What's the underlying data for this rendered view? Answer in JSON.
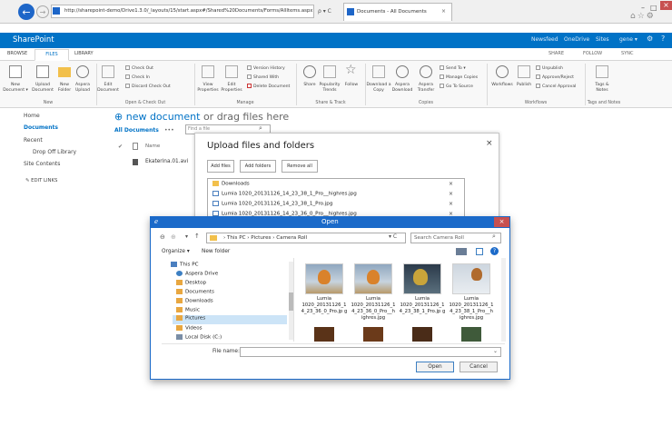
{
  "browser": {
    "url": "http://sharepoint-demo/Drive1.3.0/_layouts/15/start.aspx#/Shared%20Documents/Forms/AllItems.aspx",
    "tab_title": "Documents - All Documents",
    "addr_controls": "ρ ▾ C",
    "minimize": "–",
    "maximize": "□",
    "close": "×",
    "icons": "⌂☆⚙"
  },
  "suite": {
    "title": "SharePoint",
    "links": [
      "Newsfeed",
      "OneDrive",
      "Sites",
      "gene ▾",
      "⚙",
      "?"
    ]
  },
  "ribbon": {
    "tabs": [
      "BROWSE",
      "FILES",
      "LIBRARY"
    ],
    "actions": [
      "SHARE",
      "FOLLOW",
      "SYNC"
    ],
    "buttons": {
      "new_document": "New\nDocument ▾",
      "upload_document": "Upload\nDocument",
      "new_folder": "New\nFolder",
      "aspera_upload": "Aspera\nUpload",
      "edit_document": "Edit\nDocument",
      "view_properties": "View\nProperties",
      "edit_properties": "Edit\nProperties",
      "share": "Share",
      "popularity_trends": "Popularity\nTrends",
      "follow": "Follow",
      "download_copy": "Download a\nCopy",
      "aspera_download": "Aspera\nDownload",
      "aspera_transfer": "Aspera\nTransfer",
      "workflows": "Workflows",
      "publish": "Publish",
      "tags_notes": "Tags &\nNotes"
    },
    "small": {
      "check_out": "Check Out",
      "check_in": "Check In",
      "discard_check_out": "Discard Check Out",
      "version_history": "Version History",
      "shared_with": "Shared With",
      "delete_document": "Delete Document",
      "send_to": "Send To ▾",
      "manage_copies": "Manage Copies",
      "go_to_source": "Go To Source",
      "unpublish": "Unpublish",
      "approve_reject": "Approve/Reject",
      "cancel_approval": "Cancel Approval"
    },
    "groups": [
      "New",
      "Open & Check Out",
      "Manage",
      "Share & Track",
      "Copies",
      "Workflows",
      "Tags and Notes"
    ]
  },
  "leftnav": {
    "items": [
      "Home",
      "Documents",
      "Recent",
      "Drop Off Library",
      "Site Contents",
      "EDIT LINKS"
    ]
  },
  "content": {
    "new_document": "new document",
    "or_drag": "or drag files here",
    "all_documents": "All Documents",
    "more": "•••",
    "find_placeholder": "Find a file",
    "name_header": "Name",
    "file_row": "Ekaterina.01.avi"
  },
  "upload_dialog": {
    "title": "Upload files and folders",
    "add_files": "Add files",
    "add_folders": "Add folders",
    "remove_all": "Remove all",
    "close": "×",
    "items": [
      "Downloads",
      "Lumia 1020_20131126_14_23_38_1_Pro__highres.jpg",
      "Lumia 1020_20131126_14_23_38_1_Pro.jpg",
      "Lumia 1020_20131126_14_23_36_0_Pro__highres.jpg"
    ],
    "remove": "×"
  },
  "open_dialog": {
    "title": "Open",
    "path": "› This PC › Pictures › Camera Roll",
    "search_placeholder": "Search Camera Roll",
    "organize": "Organize ▾",
    "new_folder": "New folder",
    "tree": [
      "This PC",
      "Aspera Drive",
      "Desktop",
      "Documents",
      "Downloads",
      "Music",
      "Pictures",
      "Videos",
      "Local Disk (C:)"
    ],
    "thumbs": [
      "Lumia 1020_20131126_1 4_23_36_0_Pro.jp g",
      "Lumia 1020_20131126_1 4_23_36_0_Pro__h ighres.jpg",
      "Lumia 1020_20131126_1 4_23_38_1_Pro.jp g",
      "Lumia 1020_20131126_1 4_23_38_1_Pro__h ighres.jpg"
    ],
    "file_name_label": "File name:",
    "open_button": "Open",
    "cancel_button": "Cancel",
    "close": "×"
  }
}
